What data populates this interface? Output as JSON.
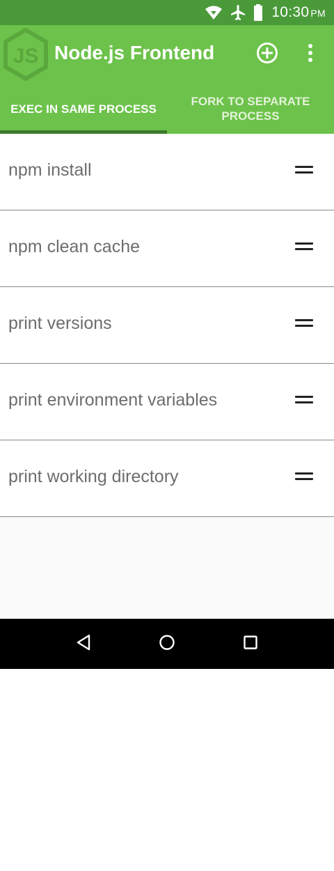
{
  "status_bar": {
    "time": "10:30",
    "ampm": "PM",
    "icons": [
      "wifi-icon",
      "airplane-mode-icon",
      "battery-icon"
    ]
  },
  "app_bar": {
    "title": "Node.js Frontend",
    "logo_text": "JS",
    "actions": [
      "add-circle-icon",
      "more-vert-icon"
    ]
  },
  "tabs": [
    {
      "label": "EXEC IN SAME PROCESS",
      "active": true
    },
    {
      "label": "FORK TO SEPARATE PROCESS",
      "active": false
    }
  ],
  "commands": [
    {
      "label": "npm install",
      "icon": "drag-handle-icon"
    },
    {
      "label": "npm clean cache",
      "icon": "drag-handle-icon"
    },
    {
      "label": "print versions",
      "icon": "drag-handle-icon"
    },
    {
      "label": "print environment variables",
      "icon": "drag-handle-icon"
    },
    {
      "label": "print working directory",
      "icon": "drag-handle-icon"
    }
  ],
  "nav_bar": {
    "buttons": [
      "back-icon",
      "home-icon",
      "recents-icon"
    ]
  },
  "colors": {
    "status_bar": "#4a9a3a",
    "app_bar": "#6cc24a",
    "tab_indicator": "#3c7a2c",
    "list_text": "#6d6d6d",
    "background": "#fafafa",
    "nav_bar": "#000000"
  }
}
